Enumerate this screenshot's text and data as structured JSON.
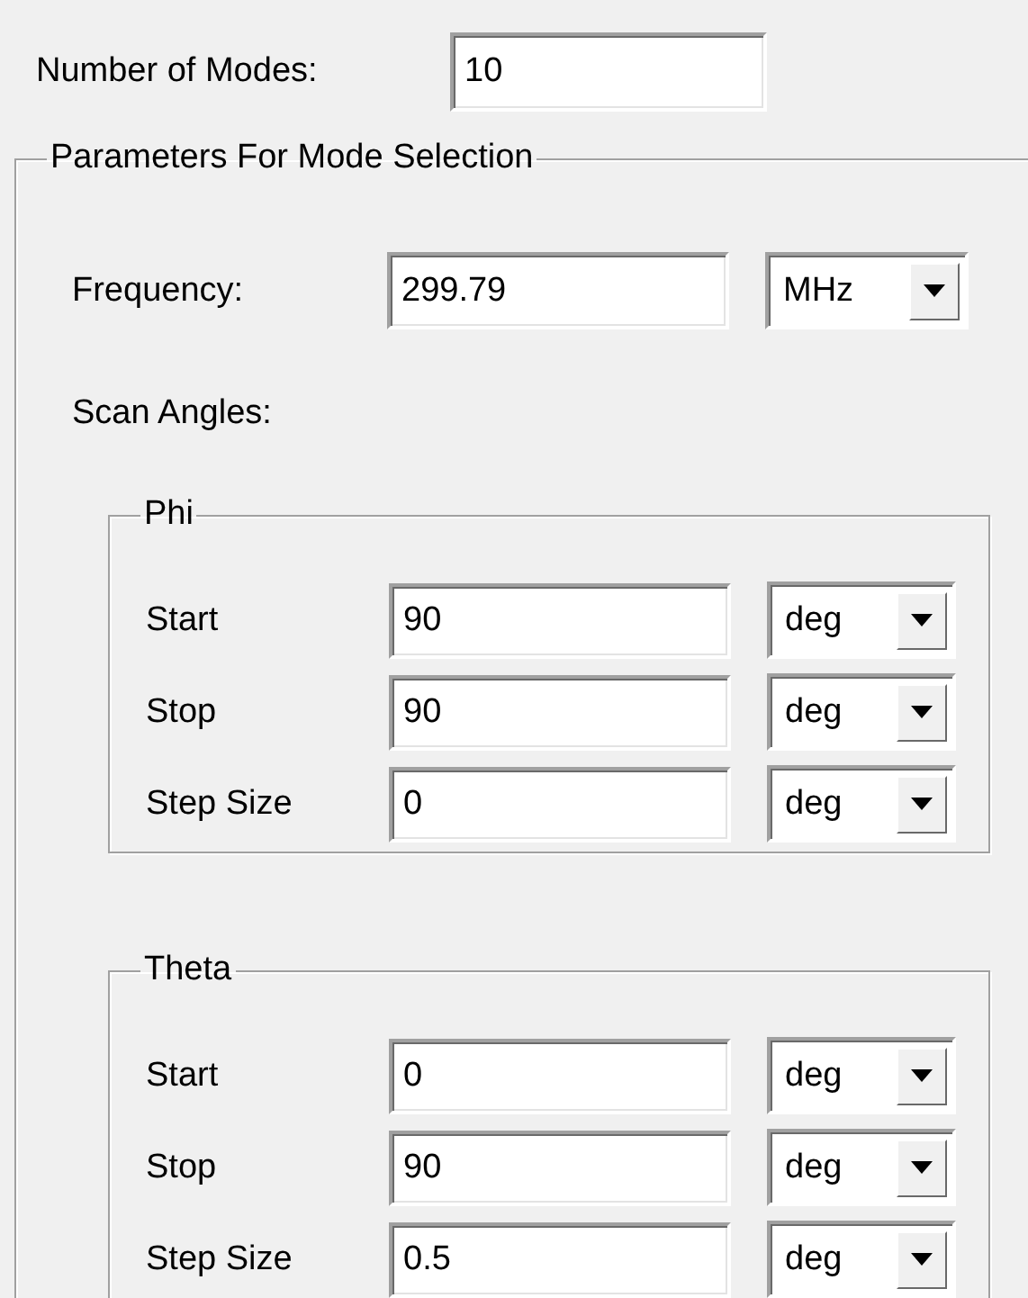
{
  "number_of_modes": {
    "label": "Number of Modes:",
    "value": "10"
  },
  "group": {
    "title": "Parameters For Mode Selection",
    "frequency": {
      "label": "Frequency:",
      "value": "299.79",
      "unit": "MHz"
    },
    "scan_angles_label": "Scan Angles:",
    "subgroups": [
      {
        "title": "Phi",
        "rows": [
          {
            "label": "Start",
            "value": "90",
            "unit": "deg"
          },
          {
            "label": "Stop",
            "value": "90",
            "unit": "deg"
          },
          {
            "label": "Step Size",
            "value": "0",
            "unit": "deg"
          }
        ]
      },
      {
        "title": "Theta",
        "rows": [
          {
            "label": "Start",
            "value": "0",
            "unit": "deg"
          },
          {
            "label": "Stop",
            "value": "90",
            "unit": "deg"
          },
          {
            "label": "Step Size",
            "value": "0.5",
            "unit": "deg"
          }
        ]
      }
    ]
  }
}
